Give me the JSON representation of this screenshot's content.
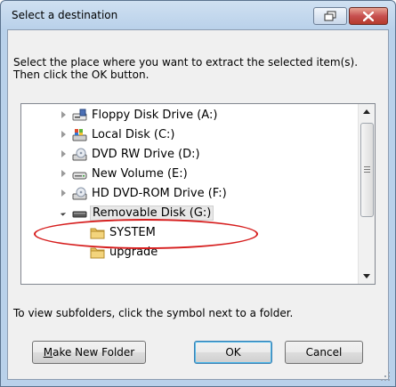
{
  "window": {
    "title": "Select a destination",
    "restore_icon": "restore-window-icon",
    "close_icon": "close-icon"
  },
  "instructions": "Select the place where you want to extract the selected item(s).  Then click the OK button.",
  "tree": {
    "items": [
      {
        "label": "Floppy Disk Drive (A:)",
        "icon": "floppy-drive-icon",
        "expanded": false
      },
      {
        "label": "Local Disk (C:)",
        "icon": "local-disk-icon",
        "expanded": false
      },
      {
        "label": "DVD RW Drive (D:)",
        "icon": "dvd-rw-drive-icon",
        "expanded": false
      },
      {
        "label": "New Volume (E:)",
        "icon": "hard-drive-icon",
        "expanded": false
      },
      {
        "label": "HD DVD-ROM Drive (F:)",
        "icon": "hd-dvd-drive-icon",
        "expanded": false
      },
      {
        "label": "Removable Disk (G:)",
        "icon": "removable-disk-icon",
        "expanded": true,
        "selected": true
      },
      {
        "label": "SYSTEM",
        "icon": "folder-icon"
      },
      {
        "label": "upgrade",
        "icon": "folder-icon"
      }
    ]
  },
  "hint": "To view subfolders, click the symbol next to a folder.",
  "buttons": {
    "make_new_folder_mnemonic": "M",
    "make_new_folder_rest": "ake New Folder",
    "ok": "OK",
    "cancel": "Cancel"
  },
  "colors": {
    "highlight_ellipse": "#d61c1c",
    "title_gradient": "#b9d1ea",
    "close_button": "#c75050"
  }
}
